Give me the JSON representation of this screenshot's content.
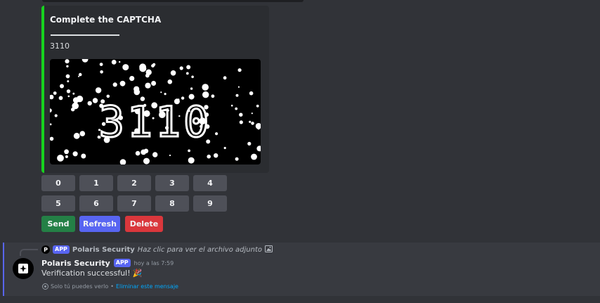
{
  "embed": {
    "title": "Complete the CAPTCHA",
    "description": "3110",
    "captcha_image_text": "3110",
    "accent_color": "#17d31f"
  },
  "keypad": {
    "row1": [
      "0",
      "1",
      "2",
      "3",
      "4"
    ],
    "row2": [
      "5",
      "6",
      "7",
      "8",
      "9"
    ]
  },
  "actions": {
    "send_label": "Send",
    "refresh_label": "Refresh",
    "delete_label": "Delete"
  },
  "reply": {
    "avatar_letter": "P",
    "app_tag": "APP",
    "author": "Polaris Security",
    "text": "Haz clic para ver el archivo adjunto",
    "image_icon": "image-icon"
  },
  "message": {
    "author": "Polaris Security",
    "app_tag": "APP",
    "timestamp": "hoy a las 7:59",
    "content": "Verification successful!",
    "emoji": "🎉",
    "ephemeral_text": "Solo tú puedes verlo",
    "ephemeral_separator": "•",
    "dismiss_link": "Eliminar este mensaje"
  },
  "colors": {
    "background": "#313338",
    "button_secondary": "#4e5058",
    "button_success": "#248046",
    "button_primary": "#5865f2",
    "button_danger": "#da373c"
  }
}
